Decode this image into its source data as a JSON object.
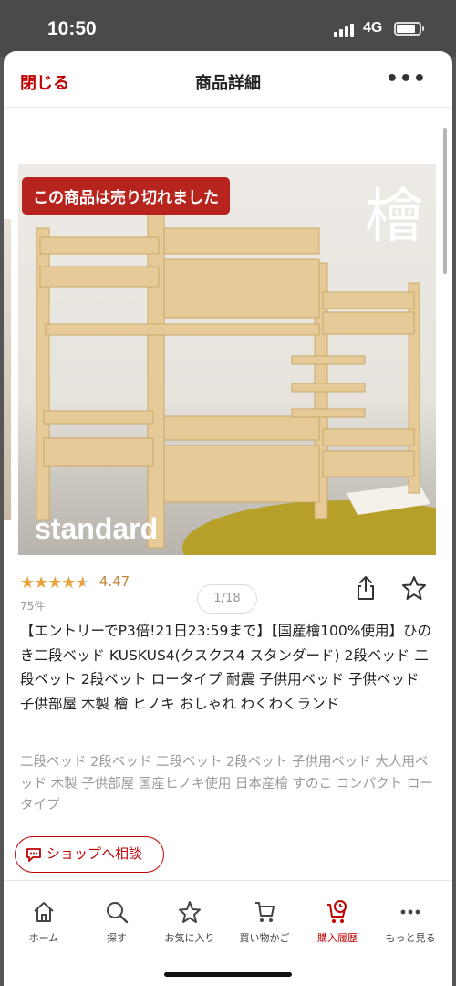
{
  "status_bar": {
    "time": "10:50",
    "network": "4G"
  },
  "header": {
    "close_label": "閉じる",
    "title": "商品詳細",
    "more_label": "•••"
  },
  "gallery": {
    "soldout_badge": "この商品は売り切れました",
    "overlay_kanji": "檜",
    "overlay_text": "standard",
    "page_indicator": "1/18"
  },
  "product": {
    "rating": 4.47,
    "rating_text": "4.47",
    "stars": [
      "★",
      "★",
      "★",
      "★",
      "★"
    ],
    "review_count": "75件",
    "title": "【エントリーでP3倍!21日23:59まで】【国産檜100%使用】ひのき二段ベッド KUSKUS4(クスクス4 スタンダード) 2段ベッド 二段ベット 2段ベット ロータイプ 耐震 子供用ベッド 子供ベッド 子供部屋 木製 檜 ヒノキ おしゃれ わくわくランド",
    "tags": "二段ベッド 2段ベッド 二段ベット 2段ベット 子供用ベッド 大人用ベッド 木製 子供部屋 国産ヒノキ使用 日本産檜 すのこ コンパクト ロータイプ"
  },
  "actions": {
    "share_icon": "share-icon",
    "favorite_icon": "star-outline-icon",
    "consult_label": "ショップへ相談"
  },
  "bottom_nav": [
    {
      "label": "ホーム",
      "icon": "home-icon"
    },
    {
      "label": "探す",
      "icon": "search-icon"
    },
    {
      "label": "お気に入り",
      "icon": "star-icon"
    },
    {
      "label": "買い物かご",
      "icon": "cart-icon"
    },
    {
      "label": "購入履歴",
      "icon": "history-cart-icon",
      "active": true
    },
    {
      "label": "もっと見る",
      "icon": "more-icon"
    }
  ],
  "colors": {
    "accent": "#bf0000",
    "star": "#e8a33d",
    "badge": "#b7241d"
  }
}
